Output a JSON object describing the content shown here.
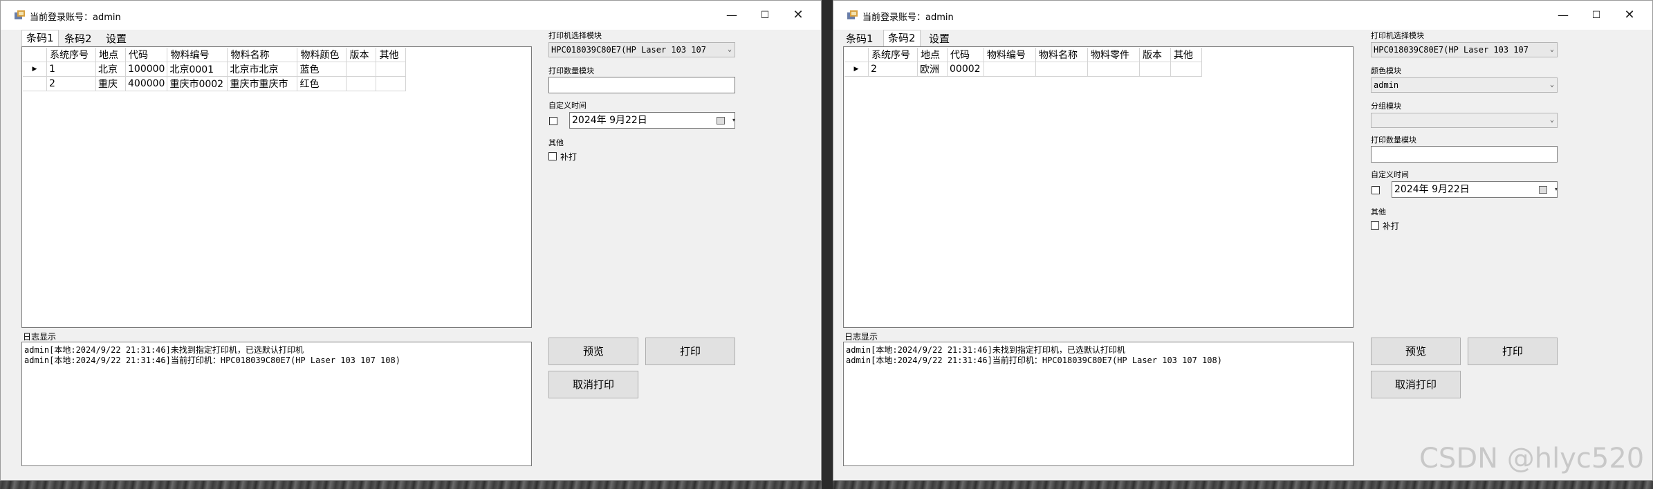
{
  "window1": {
    "title": "当前登录账号：admin",
    "controls": {
      "minimize": "—",
      "maximize": "☐",
      "close": "✕"
    },
    "tabs": [
      "条码1",
      "条码2",
      "设置"
    ],
    "active_tab": "条码1",
    "grid": {
      "columns": [
        "系统序号",
        "地点",
        "代码",
        "物料编号",
        "物料名称",
        "物料颜色",
        "版本",
        "其他"
      ],
      "rows": [
        {
          "indicator": "▶",
          "cells": [
            "1",
            "北京",
            "100000",
            "北京0001",
            "北京市北京",
            "蓝色",
            "",
            ""
          ]
        },
        {
          "indicator": "",
          "cells": [
            "2",
            "重庆",
            "400000",
            "重庆市0002",
            "重庆市重庆市",
            "红色",
            "",
            ""
          ]
        }
      ]
    },
    "log": {
      "label": "日志显示",
      "lines": [
        "admin[本地:2024/9/22 21:31:46]未找到指定打印机，已选默认打印机",
        "admin[本地:2024/9/22 21:31:46]当前打印机：HPC018039C80E7(HP Laser 103 107 108)"
      ]
    },
    "right": {
      "printer_label": "打印机选择模块",
      "printer_value": "HPC018039C80E7(HP Laser 103 107",
      "qty_label": "打印数量模块",
      "qty_value": "",
      "time_label": "自定义时间",
      "date_value": "2024年  9月22日",
      "other_label": "其他",
      "reprint_label": "补打",
      "preview_button": "预览",
      "print_button": "打印",
      "cancel_button": "取消打印"
    }
  },
  "window2": {
    "title": "当前登录账号：admin",
    "controls": {
      "minimize": "—",
      "maximize": "☐",
      "close": "✕"
    },
    "tabs": [
      "条码1",
      "条码2",
      "设置"
    ],
    "active_tab": "条码2",
    "grid": {
      "columns": [
        "系统序号",
        "地点",
        "代码",
        "物料编号",
        "物料名称",
        "物料零件",
        "版本",
        "其他"
      ],
      "rows": [
        {
          "indicator": "▶",
          "cells": [
            "2",
            "欧洲",
            "00002",
            "",
            "",
            "",
            "",
            ""
          ]
        }
      ]
    },
    "log": {
      "label": "日志显示",
      "lines": [
        "admin[本地:2024/9/22 21:31:46]未找到指定打印机，已选默认打印机",
        "admin[本地:2024/9/22 21:31:46]当前打印机：HPC018039C80E7(HP Laser 103 107 108)"
      ]
    },
    "right": {
      "printer_label": "打印机选择模块",
      "printer_value": "HPC018039C80E7(HP Laser 103 107",
      "color_label": "颜色模块",
      "color_value": "admin",
      "group_label": "分组模块",
      "group_value": "",
      "qty_label": "打印数量模块",
      "qty_value": "",
      "time_label": "自定义时间",
      "date_value": "2024年  9月22日",
      "other_label": "其他",
      "reprint_label": "补打",
      "preview_button": "预览",
      "print_button": "打印",
      "cancel_button": "取消打印"
    }
  },
  "watermark": "CSDN @hlyc520"
}
